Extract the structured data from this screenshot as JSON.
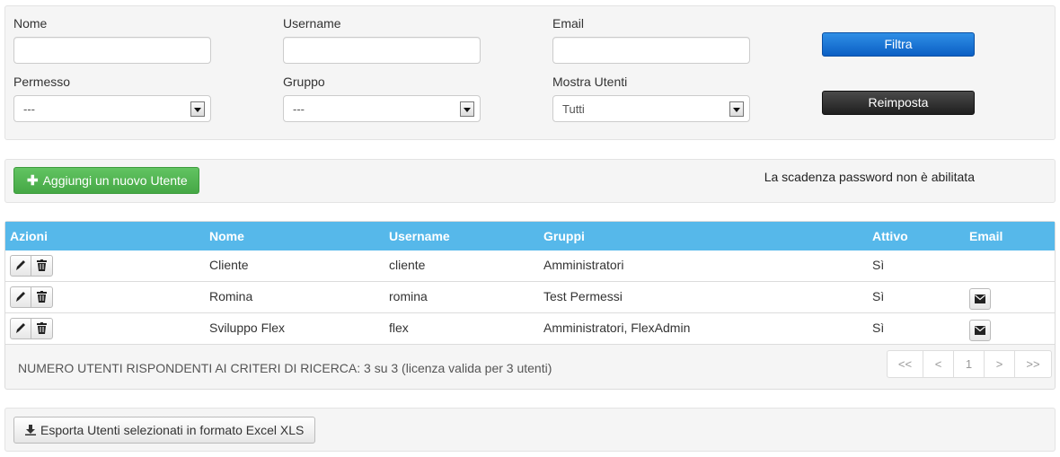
{
  "filters": {
    "nome_label": "Nome",
    "username_label": "Username",
    "email_label": "Email",
    "permesso_label": "Permesso",
    "permesso_value": "---",
    "gruppo_label": "Gruppo",
    "gruppo_value": "---",
    "mostra_label": "Mostra Utenti",
    "mostra_value": "Tutti",
    "filtra_label": "Filtra",
    "reimposta_label": "Reimposta"
  },
  "toolbar": {
    "add_user_label": "Aggiungi un nuovo Utente",
    "password_note": "La scadenza password non è abilitata"
  },
  "table": {
    "headers": {
      "azioni": "Azioni",
      "nome": "Nome",
      "username": "Username",
      "gruppi": "Gruppi",
      "attivo": "Attivo",
      "email": "Email"
    },
    "rows": [
      {
        "nome": "Cliente",
        "username": "cliente",
        "gruppi": "Amministratori",
        "attivo": "Sì",
        "has_email": false
      },
      {
        "nome": "Romina",
        "username": "romina",
        "gruppi": "Test Permessi",
        "attivo": "Sì",
        "has_email": true
      },
      {
        "nome": "Sviluppo Flex",
        "username": "flex",
        "gruppi": "Amministratori, FlexAdmin",
        "attivo": "Sì",
        "has_email": true
      }
    ],
    "result_count": "NUMERO UTENTI RISPONDENTI AI CRITERI DI RICERCA: 3 su 3 (licenza valida per 3 utenti)",
    "pager": {
      "first": "<<",
      "prev": "<",
      "page": "1",
      "next": ">",
      "last": ">>"
    }
  },
  "export": {
    "label": "Esporta Utenti selezionati in formato Excel XLS"
  },
  "colors": {
    "header_blue": "#56b8ea",
    "filtra_blue": "#0b5fc4",
    "add_green": "#45a845"
  }
}
